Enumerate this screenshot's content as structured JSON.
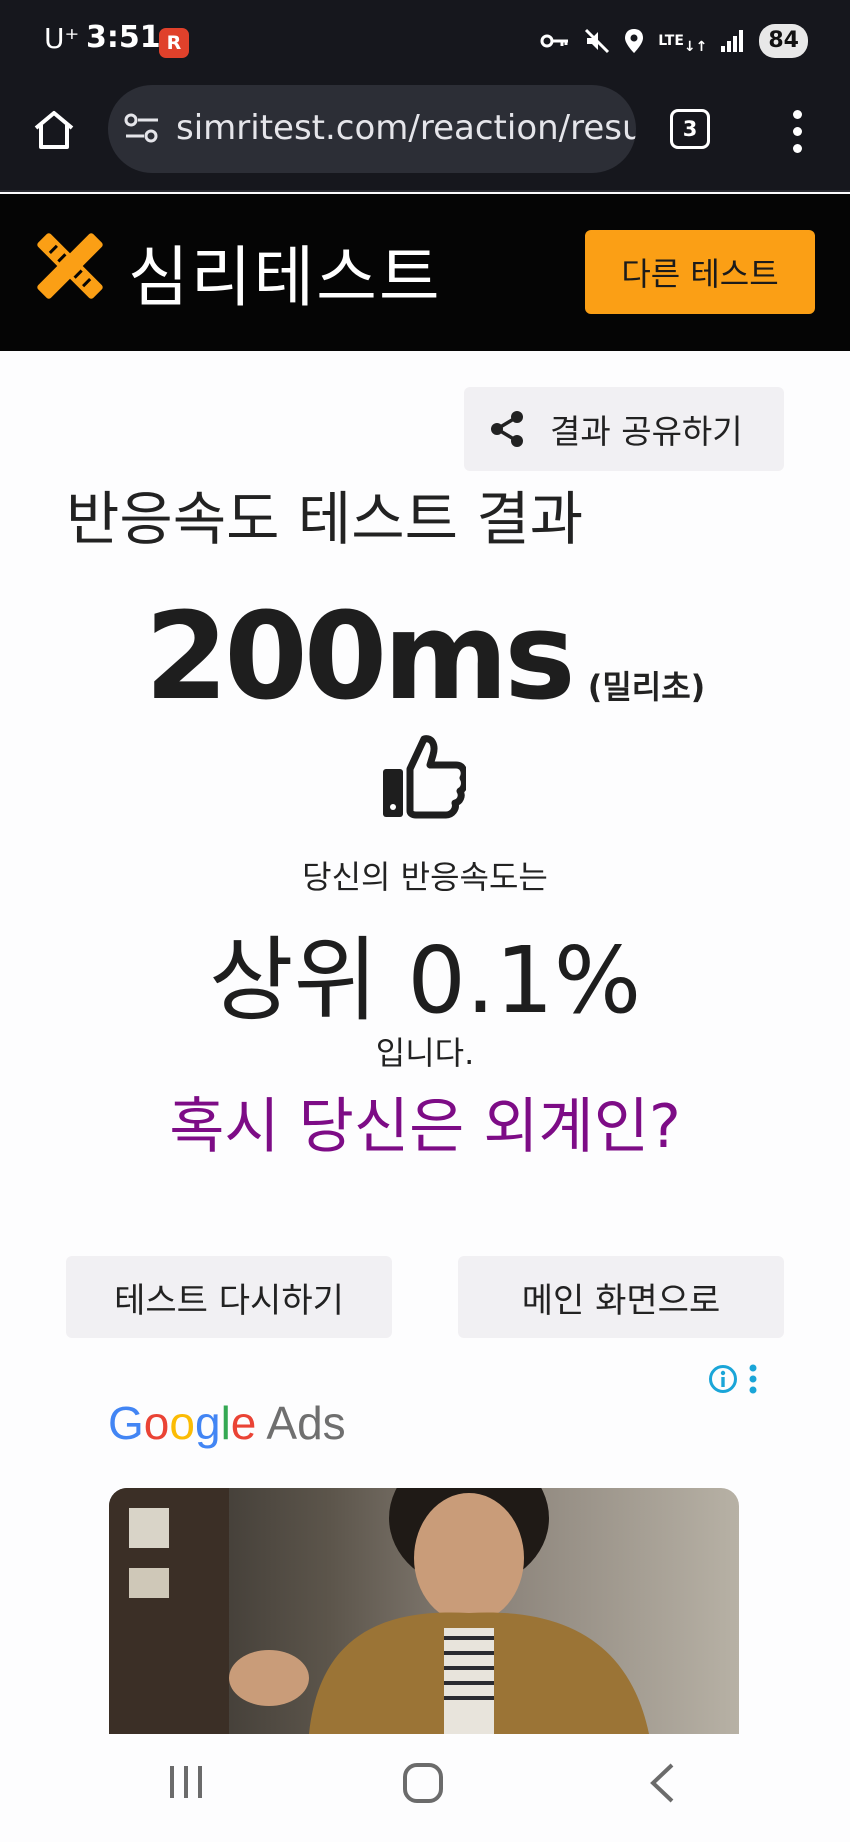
{
  "status_bar": {
    "carrier": "U⁺",
    "time": "3:51",
    "app_badge": "R",
    "network": "LTE",
    "battery": "84",
    "icons": [
      "key-icon",
      "mute-icon",
      "location-icon",
      "lte-icon",
      "signal-icon",
      "battery-icon"
    ]
  },
  "browser": {
    "url": "simritest.com/reaction/result",
    "tab_count": "3",
    "icons": [
      "home-icon",
      "site-settings-icon",
      "tabs-icon",
      "more-menu-icon"
    ]
  },
  "site_header": {
    "logo_text": "심리테스트",
    "other_test_label": "다른 테스트",
    "colors": {
      "background": "#050505",
      "accent": "#fb9f15"
    }
  },
  "result": {
    "share_label": "결과 공유하기",
    "title": "반응속도 테스트 결과",
    "value": "200ms",
    "unit": "(밀리초)",
    "line1": "당신의 반응속도는",
    "rank": "상위 0.1%",
    "line2": "입니다.",
    "verdict": "혹시 당신은 외계인?",
    "verdict_color": "#7d0c86"
  },
  "actions": {
    "retry_label": "테스트 다시하기",
    "main_label": "메인 화면으로"
  },
  "ad": {
    "brand_google": "Google",
    "brand_ads": "Ads",
    "icons": [
      "info-icon",
      "ad-options-icon"
    ]
  },
  "nav_bar": {
    "icons": [
      "recents-icon",
      "home-nav-icon",
      "back-icon"
    ]
  }
}
